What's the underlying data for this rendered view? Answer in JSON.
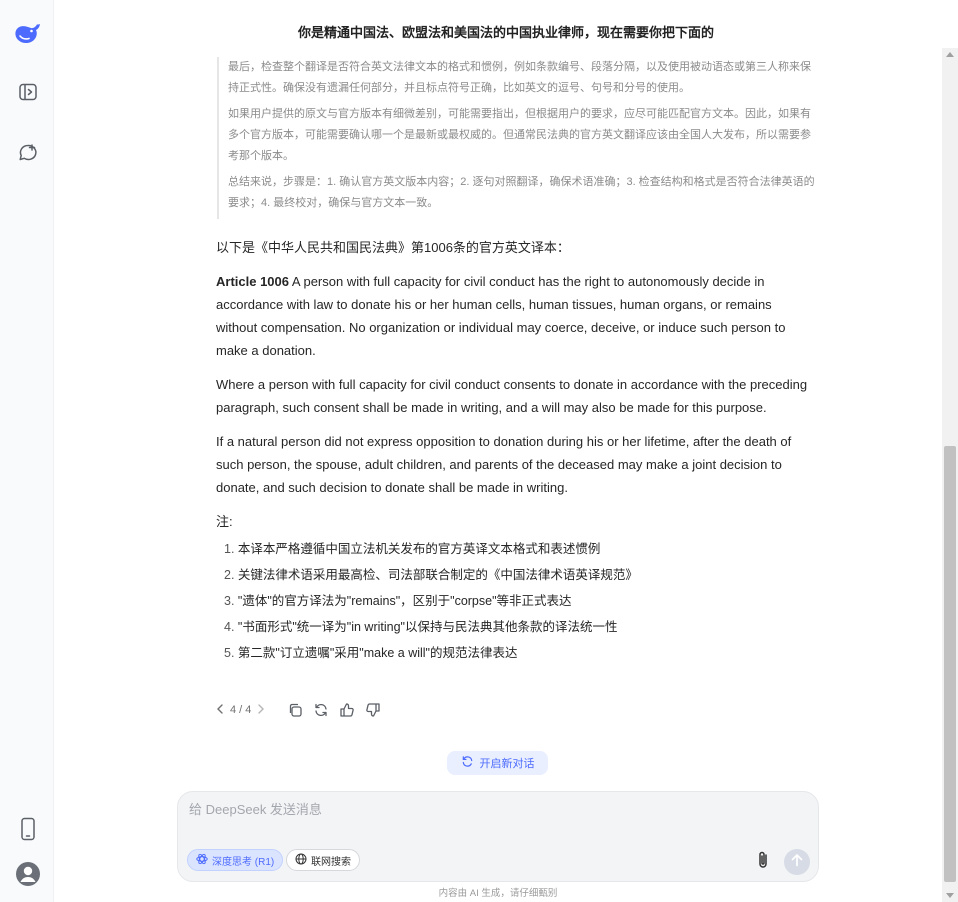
{
  "header": {
    "title": "你是精通中国法、欧盟法和美国法的中国执业律师，现在需要你把下面的"
  },
  "sidebar": {
    "logo_icon": "whale-logo-icon",
    "items": [
      {
        "icon": "sidebar-toggle-icon"
      },
      {
        "icon": "new-chat-icon"
      },
      {
        "icon": "phone-icon"
      },
      {
        "icon": "avatar-icon"
      }
    ]
  },
  "thinking": [
    "最后，检查整个翻译是否符合英文法律文本的格式和惯例，例如条款编号、段落分隔，以及使用被动语态或第三人称来保持正式性。确保没有遗漏任何部分，并且标点符号正确，比如英文的逗号、句号和分号的使用。",
    "如果用户提供的原文与官方版本有细微差别，可能需要指出，但根据用户的要求，应尽可能匹配官方文本。因此，如果有多个官方版本，可能需要确认哪一个是最新或最权威的。但通常民法典的官方英文翻译应该由全国人大发布，所以需要参考那个版本。",
    "总结来说，步骤是：1. 确认官方英文版本内容；2. 逐句对照翻译，确保术语准确；3. 检查结构和格式是否符合法律英语的要求；4. 最终校对，确保与官方文本一致。"
  ],
  "answer": {
    "intro": "以下是《中华人民共和国民法典》第1006条的官方英文译本：",
    "article_label": "Article 1006",
    "paragraph_1": " A person with full capacity for civil conduct has the right to autonomously decide in accordance with law to donate his or her human cells, human tissues, human organs, or remains without compensation. No organization or individual may coerce, deceive, or induce such person to make a donation.",
    "paragraph_2": "Where a person with full capacity for civil conduct consents to donate in accordance with the preceding paragraph, such consent shall be made in writing, and a will may also be made for this purpose.",
    "paragraph_3": "If a natural person did not express opposition to donation during his or her lifetime, after the death of such person, the spouse, adult children, and parents of the deceased may make a joint decision to donate, and such decision to donate shall be made in writing.",
    "notes_label": "注:",
    "notes": [
      {
        "num": "1.",
        "text": "本译本严格遵循中国立法机关发布的官方英译文本格式和表述惯例"
      },
      {
        "num": "2.",
        "text": "关键法律术语采用最高检、司法部联合制定的《中国法律术语英译规范》"
      },
      {
        "num": "3.",
        "text": "\"遗体\"的官方译法为\"remains\"，区别于\"corpse\"等非正式表达"
      },
      {
        "num": "4.",
        "text": "\"书面形式\"统一译为\"in writing\"以保持与民法典其他条款的译法统一性"
      },
      {
        "num": "5.",
        "text": "第二款\"订立遗嘱\"采用\"make a will\"的规范法律表达"
      }
    ]
  },
  "actions": {
    "pager": "4 / 4"
  },
  "new_chat_label": "开启新对话",
  "input": {
    "placeholder": "给 DeepSeek 发送消息",
    "value": "",
    "deep_think_label": "深度思考 (R1)",
    "web_search_label": "联网搜索"
  },
  "disclaimer": "内容由 AI 生成，请仔细甄别",
  "colors": {
    "accent": "#4d6bfe",
    "accent_bg": "#e9efff"
  }
}
